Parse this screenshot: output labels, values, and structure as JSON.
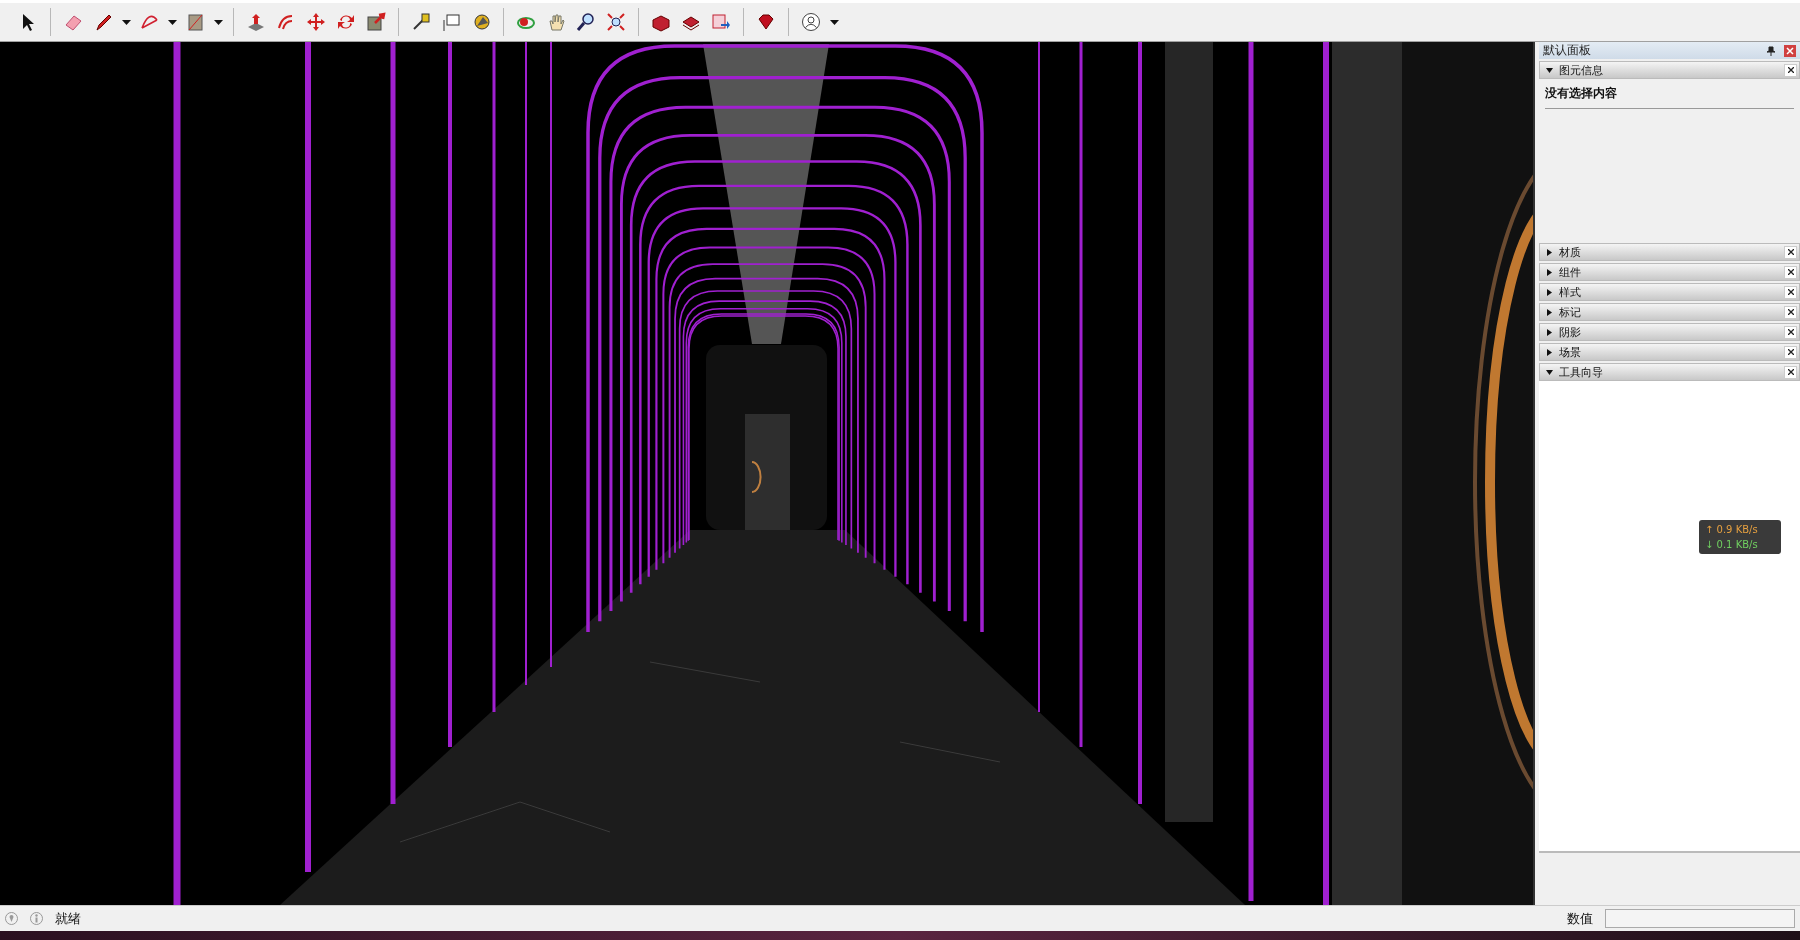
{
  "panel": {
    "title": "默认面板",
    "sections": [
      {
        "label": "图元信息",
        "expanded": true,
        "content": "没有选择内容"
      },
      {
        "label": "材质",
        "expanded": false
      },
      {
        "label": "组件",
        "expanded": false
      },
      {
        "label": "样式",
        "expanded": false
      },
      {
        "label": "标记",
        "expanded": false
      },
      {
        "label": "阴影",
        "expanded": false
      },
      {
        "label": "场景",
        "expanded": false
      },
      {
        "label": "工具向导",
        "expanded": true
      }
    ]
  },
  "network_monitor": {
    "upload": "↑ 0.9 KB/s",
    "download": "↓ 0.1 KB/s"
  },
  "status_bar": {
    "message": "就绪",
    "measurement_label": "数值"
  }
}
